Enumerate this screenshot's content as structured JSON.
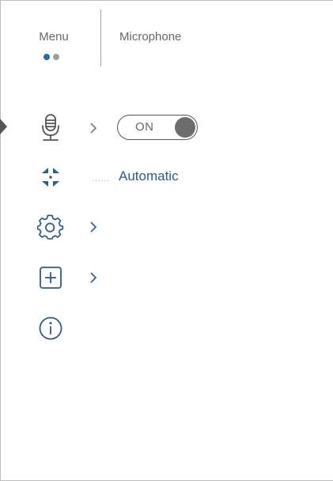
{
  "header": {
    "menu_label": "Menu",
    "title": "Microphone",
    "pages": [
      {
        "active": true
      },
      {
        "active": false
      }
    ]
  },
  "menu_items": [
    {
      "icon": "microphone-icon",
      "has_submenu": true,
      "selected": true
    },
    {
      "icon": "focus-brackets-icon",
      "has_submenu": false,
      "selected": false
    },
    {
      "icon": "gear-icon",
      "has_submenu": true,
      "selected": false
    },
    {
      "icon": "plus-box-icon",
      "has_submenu": true,
      "selected": false
    },
    {
      "icon": "info-icon",
      "has_submenu": false,
      "selected": false
    }
  ],
  "microphone": {
    "toggle_label": "ON",
    "enabled": true
  },
  "focus_mode": {
    "leader": "······",
    "value": "Automatic"
  },
  "colors": {
    "accent": "#2b5b8c",
    "dot_active": "#2b6aa8",
    "dot_inactive": "#9e9e9e",
    "text": "#666666",
    "toggle_knob": "#6d6d6d"
  }
}
